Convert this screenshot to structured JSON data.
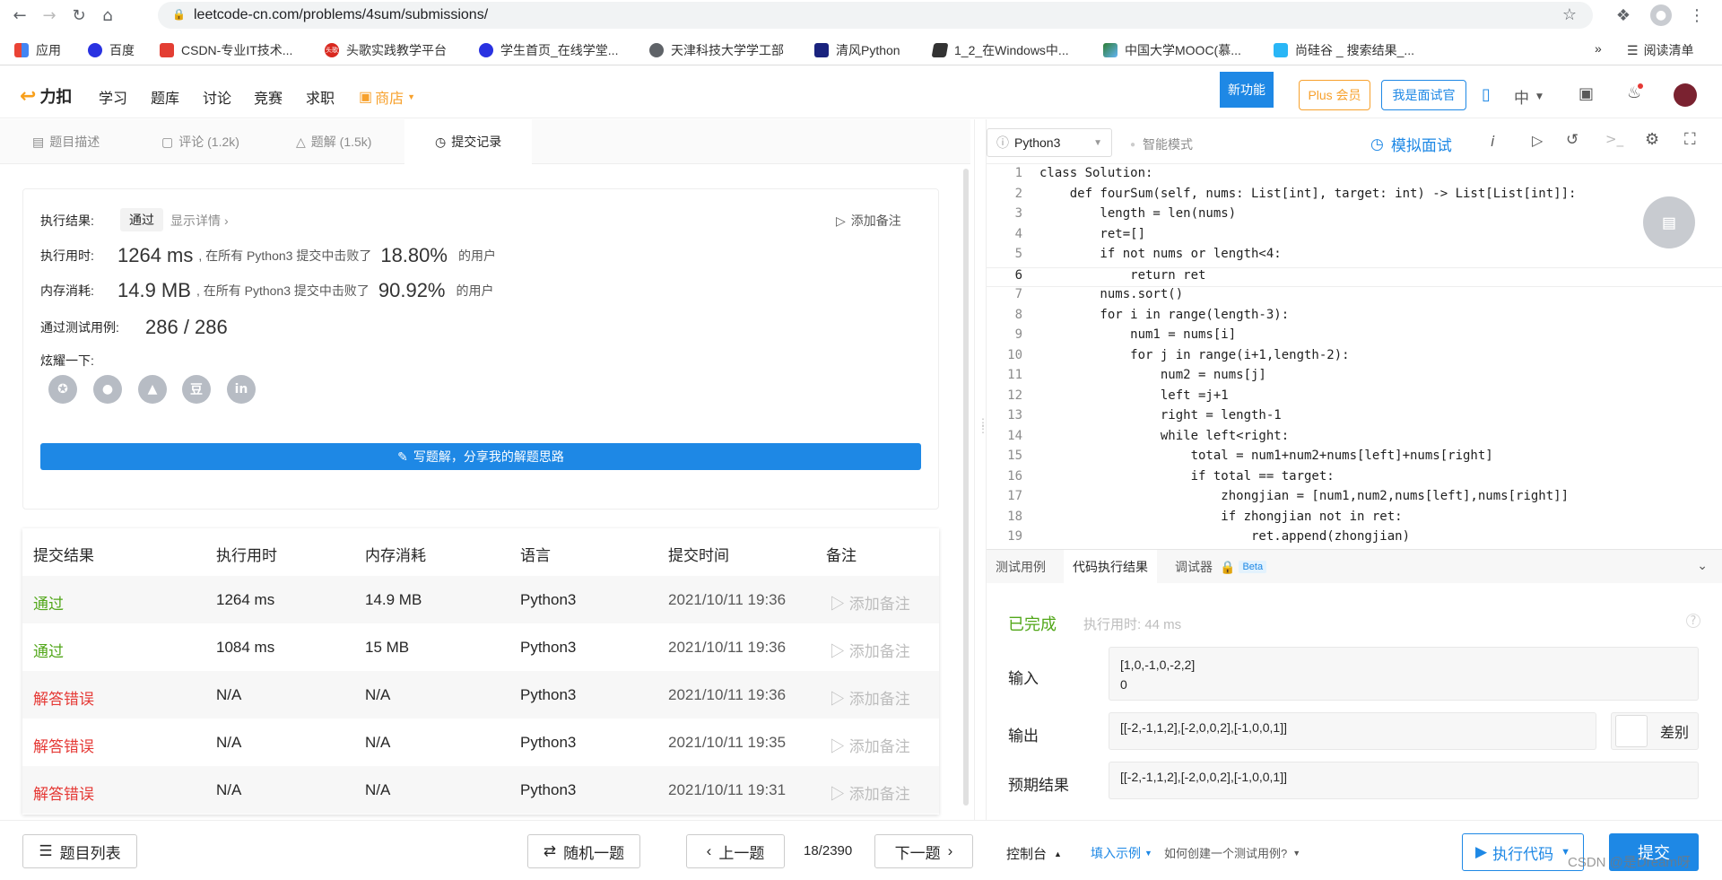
{
  "browser": {
    "url": "leetcode-cn.com/problems/4sum/submissions/",
    "bookmarks": [
      "应用",
      "百度",
      "CSDN-专业IT技术...",
      "头歌实践教学平台",
      "学生首页_在线学堂...",
      "天津科技大学学工部",
      "清风Python",
      "1_2_在Windows中...",
      "中国大学MOOC(慕...",
      "尚硅谷 _ 搜索结果_...",
      "»",
      "阅读清单"
    ],
    "bookmark_badge": "头歌"
  },
  "header": {
    "logo": "力扣",
    "nav": [
      "学习",
      "题库",
      "讨论",
      "竞赛",
      "求职",
      "商店"
    ],
    "new_feature": "新功能",
    "plus": "Plus 会员",
    "interviewer": "我是面试官",
    "lang": "中"
  },
  "left_tabs": [
    "题目描述",
    "评论 (1.2k)",
    "题解 (1.5k)",
    "提交记录"
  ],
  "result": {
    "status_label": "执行结果:",
    "status": "通过",
    "details": "显示详情",
    "add_note": "添加备注",
    "time_label": "执行用时:",
    "time_value": "1264 ms",
    "time_desc": ", 在所有 Python3 提交中击败了",
    "time_pct": "18.80%",
    "users": "的用户",
    "mem_label": "内存消耗:",
    "mem_value": "14.9 MB",
    "mem_desc": ", 在所有 Python3 提交中击败了",
    "mem_pct": "90.92%",
    "cases_label": "通过测试用例:",
    "cases_value": "286 / 286",
    "share_label": "炫耀一下:",
    "share_icons": [
      "豆",
      "in"
    ],
    "write_solution": "写题解，分享我的解题思路"
  },
  "table": {
    "headers": [
      "提交结果",
      "执行用时",
      "内存消耗",
      "语言",
      "提交时间",
      "备注"
    ],
    "rows": [
      {
        "result": "通过",
        "time": "1264 ms",
        "mem": "14.9 MB",
        "lang": "Python3",
        "date": "2021/10/11 19:36",
        "note": "添加备注"
      },
      {
        "result": "通过",
        "time": "1084 ms",
        "mem": "15 MB",
        "lang": "Python3",
        "date": "2021/10/11 19:36",
        "note": "添加备注"
      },
      {
        "result": "解答错误",
        "time": "N/A",
        "mem": "N/A",
        "lang": "Python3",
        "date": "2021/10/11 19:36",
        "note": "添加备注"
      },
      {
        "result": "解答错误",
        "time": "N/A",
        "mem": "N/A",
        "lang": "Python3",
        "date": "2021/10/11 19:35",
        "note": "添加备注"
      },
      {
        "result": "解答错误",
        "time": "N/A",
        "mem": "N/A",
        "lang": "Python3",
        "date": "2021/10/11 19:31",
        "note": "添加备注"
      }
    ]
  },
  "bottom_left": {
    "problem_list": "题目列表",
    "random": "随机一题",
    "prev": "上一题",
    "page": "18/2390",
    "next": "下一题"
  },
  "editor": {
    "language": "Python3",
    "smart_mode": "智能模式",
    "mock_interview": "模拟面试",
    "info_icon": "i",
    "lines": [
      "class Solution:",
      "    def fourSum(self, nums: List[int], target: int) -> List[List[int]]:",
      "        length = len(nums)",
      "        ret=[]",
      "        if not nums or length<4:",
      "            return ret",
      "        nums.sort()",
      "        for i in range(length-3):",
      "            num1 = nums[i]",
      "            for j in range(i+1,length-2):",
      "                num2 = nums[j]",
      "                left =j+1",
      "                right = length-1",
      "                while left<right:",
      "                    total = num1+num2+nums[left]+nums[right]",
      "                    if total == target:",
      "                        zhongjian = [num1,num2,nums[left],nums[right]]",
      "                        if zhongjian not in ret:",
      "                            ret.append(zhongjian)"
    ]
  },
  "console": {
    "tabs": [
      "测试用例",
      "代码执行结果",
      "调试器"
    ],
    "beta": "Beta",
    "done": "已完成",
    "exec_time": "执行用时: 44 ms",
    "help_icon": "?",
    "input_label": "输入",
    "input_lines": [
      "[1,0,-1,0,-2,2]",
      "0"
    ],
    "output_label": "输出",
    "output_value": "[[-2,-1,1,2],[-2,0,0,2],[-1,0,0,1]]",
    "diff": "差别",
    "expected_label": "预期结果",
    "expected_value": "[[-2,-1,1,2],[-2,0,0,2],[-1,0,0,1]]",
    "console_btn": "控制台",
    "fill_example": "填入示例",
    "how_create": "如何创建一个测试用例?",
    "run_code": "执行代码",
    "submit": "提交"
  },
  "watermark": "CSDN @是Dream呀",
  "colors": {
    "accent": "#1e88e5",
    "success": "#52a71a",
    "error": "#e53935",
    "store": "#f7a12d"
  }
}
